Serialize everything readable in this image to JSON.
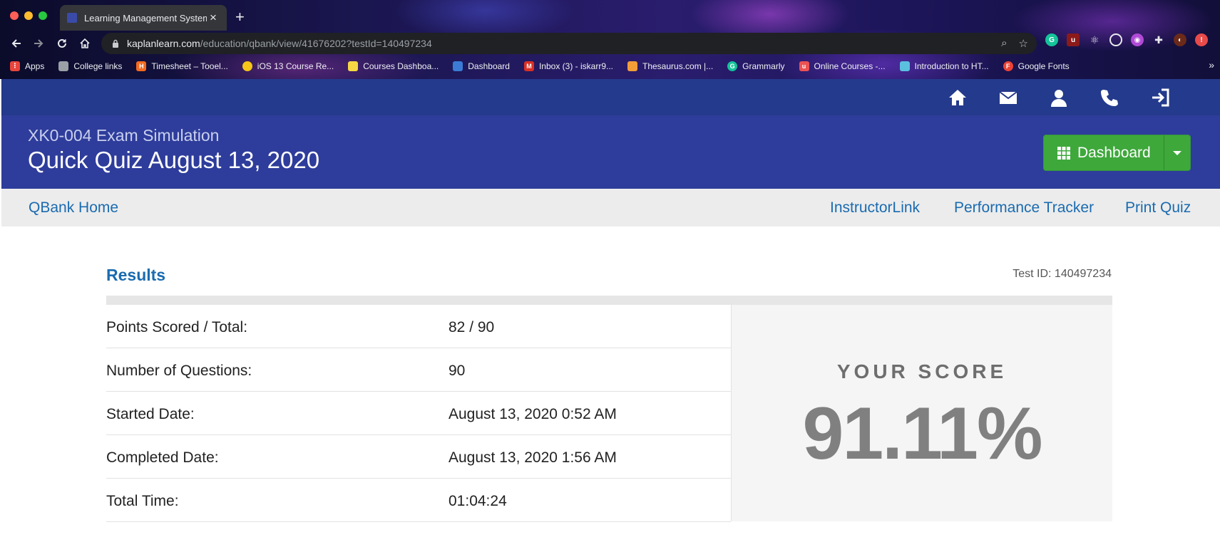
{
  "browser": {
    "tab_title": "Learning Management System",
    "url_domain": "kaplanlearn.com",
    "url_path": "/education/qbank/view/41676202?testId=140497234",
    "bookmarks": [
      {
        "label": "Apps",
        "icon": "apps-grid-icon",
        "color": "#e8453c"
      },
      {
        "label": "College links",
        "icon": "folder-icon",
        "color": "#9aa0a6"
      },
      {
        "label": "Timesheet – Tooel...",
        "icon": "h-icon",
        "color": "#f26b21"
      },
      {
        "label": "iOS 13 Course Re...",
        "icon": "course-icon",
        "color": "#f5c518"
      },
      {
        "label": "Courses Dashboa...",
        "icon": "crown-icon",
        "color": "#f6d743"
      },
      {
        "label": "Dashboard",
        "icon": "bars-icon",
        "color": "#3b7bd6"
      },
      {
        "label": "Inbox (3) - iskarr9...",
        "icon": "gmail-icon",
        "color": "#d93025"
      },
      {
        "label": "Thesaurus.com |...",
        "icon": "thesaurus-icon",
        "color": "#f29d38"
      },
      {
        "label": "Grammarly",
        "icon": "grammarly-icon",
        "color": "#15c39a"
      },
      {
        "label": "Online Courses -...",
        "icon": "udemy-icon",
        "color": "#ec5252"
      },
      {
        "label": "Introduction to HT...",
        "icon": "html-icon",
        "color": "#5bc0de"
      },
      {
        "label": "Google Fonts",
        "icon": "google-fonts-icon",
        "color": "#ea4335"
      }
    ]
  },
  "header": {
    "subtitle": "XK0-004 Exam Simulation",
    "title": "Quick Quiz August 13, 2020",
    "dashboard_label": "Dashboard"
  },
  "subnav": {
    "home": "QBank Home",
    "instructor": "InstructorLink",
    "performance": "Performance Tracker",
    "print": "Print Quiz"
  },
  "results": {
    "title": "Results",
    "test_id": "Test ID: 140497234",
    "rows": [
      {
        "label": "Points Scored / Total:",
        "value": "82 / 90"
      },
      {
        "label": "Number of Questions:",
        "value": "90"
      },
      {
        "label": "Started Date:",
        "value": "August 13, 2020 0:52 AM"
      },
      {
        "label": "Completed Date:",
        "value": "August 13, 2020 1:56 AM"
      },
      {
        "label": "Total Time:",
        "value": "01:04:24"
      }
    ],
    "score_label": "YOUR SCORE",
    "score_value": "91.11%"
  },
  "colors": {
    "topbar": "#243a8c",
    "header": "#2e3d9b",
    "link": "#1a6bb0",
    "dashboard_button": "#3ea83b"
  }
}
